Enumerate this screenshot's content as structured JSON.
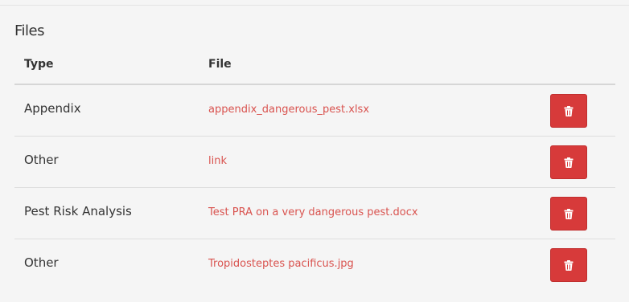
{
  "panel": {
    "title": "Files"
  },
  "table": {
    "headers": {
      "type": "Type",
      "file": "File"
    },
    "rows": [
      {
        "type": "Appendix",
        "file": "appendix_dangerous_pest.xlsx",
        "action_icon": "trash-icon"
      },
      {
        "type": "Other",
        "file": "link",
        "action_icon": "trash-icon"
      },
      {
        "type": "Pest Risk Analysis",
        "file": "Test PRA on a very dangerous pest.docx",
        "action_icon": "trash-icon"
      },
      {
        "type": "Other",
        "file": "Tropidosteptes pacificus.jpg",
        "action_icon": "trash-icon"
      }
    ]
  },
  "colors": {
    "link": "#d9534f",
    "delete_button": "#d73a3a",
    "background": "#f5f5f5"
  }
}
